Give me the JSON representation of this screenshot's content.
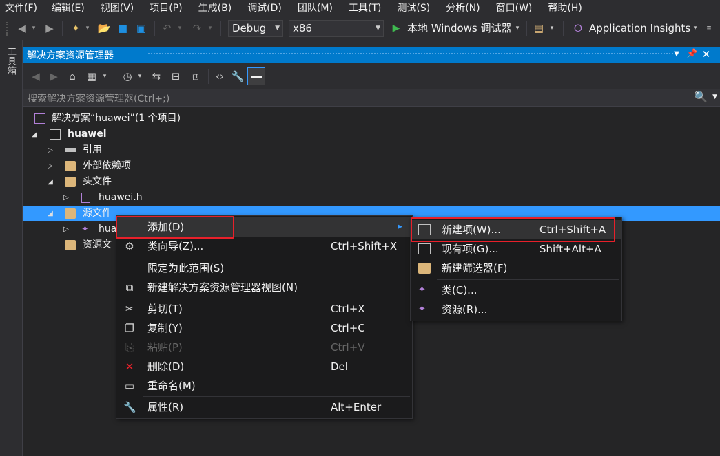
{
  "menubar": {
    "items": [
      "文件(F)",
      "编辑(E)",
      "视图(V)",
      "项目(P)",
      "生成(B)",
      "调试(D)",
      "团队(M)",
      "工具(T)",
      "测试(S)",
      "分析(N)",
      "窗口(W)",
      "帮助(H)"
    ]
  },
  "toolbar": {
    "config": "Debug",
    "platform": "x86",
    "run_label": "本地 Windows 调试器",
    "insights_label": "Application Insights"
  },
  "toolbox": {
    "label": "工具箱"
  },
  "panel": {
    "title": "解决方案资源管理器",
    "search_placeholder": "搜索解决方案资源管理器(Ctrl+;)"
  },
  "tree": {
    "solution": "解决方案“huawei”(1 个项目)",
    "project": "huawei",
    "references": "引用",
    "external_deps": "外部依赖项",
    "header_files": "头文件",
    "header_file_1": "huawei.h",
    "source_files": "源文件",
    "source_file_1": "hua",
    "resource_files": "资源文"
  },
  "context_menu": {
    "items": [
      {
        "label": "添加(D)",
        "shortcut": ""
      },
      {
        "label": "类向导(Z)...",
        "shortcut": "Ctrl+Shift+X"
      },
      {
        "label": "限定为此范围(S)",
        "shortcut": ""
      },
      {
        "label": "新建解决方案资源管理器视图(N)",
        "shortcut": ""
      },
      {
        "label": "剪切(T)",
        "shortcut": "Ctrl+X"
      },
      {
        "label": "复制(Y)",
        "shortcut": "Ctrl+C"
      },
      {
        "label": "粘贴(P)",
        "shortcut": "Ctrl+V"
      },
      {
        "label": "删除(D)",
        "shortcut": "Del"
      },
      {
        "label": "重命名(M)",
        "shortcut": ""
      },
      {
        "label": "属性(R)",
        "shortcut": "Alt+Enter"
      }
    ]
  },
  "submenu": {
    "items": [
      {
        "label": "新建项(W)...",
        "shortcut": "Ctrl+Shift+A"
      },
      {
        "label": "现有项(G)...",
        "shortcut": "Shift+Alt+A"
      },
      {
        "label": "新建筛选器(F)",
        "shortcut": ""
      },
      {
        "label": "类(C)...",
        "shortcut": ""
      },
      {
        "label": "资源(R)...",
        "shortcut": ""
      }
    ]
  },
  "colors": {
    "accent": "#007acc",
    "selection": "#3399ff",
    "highlight_box": "#e8202a"
  }
}
